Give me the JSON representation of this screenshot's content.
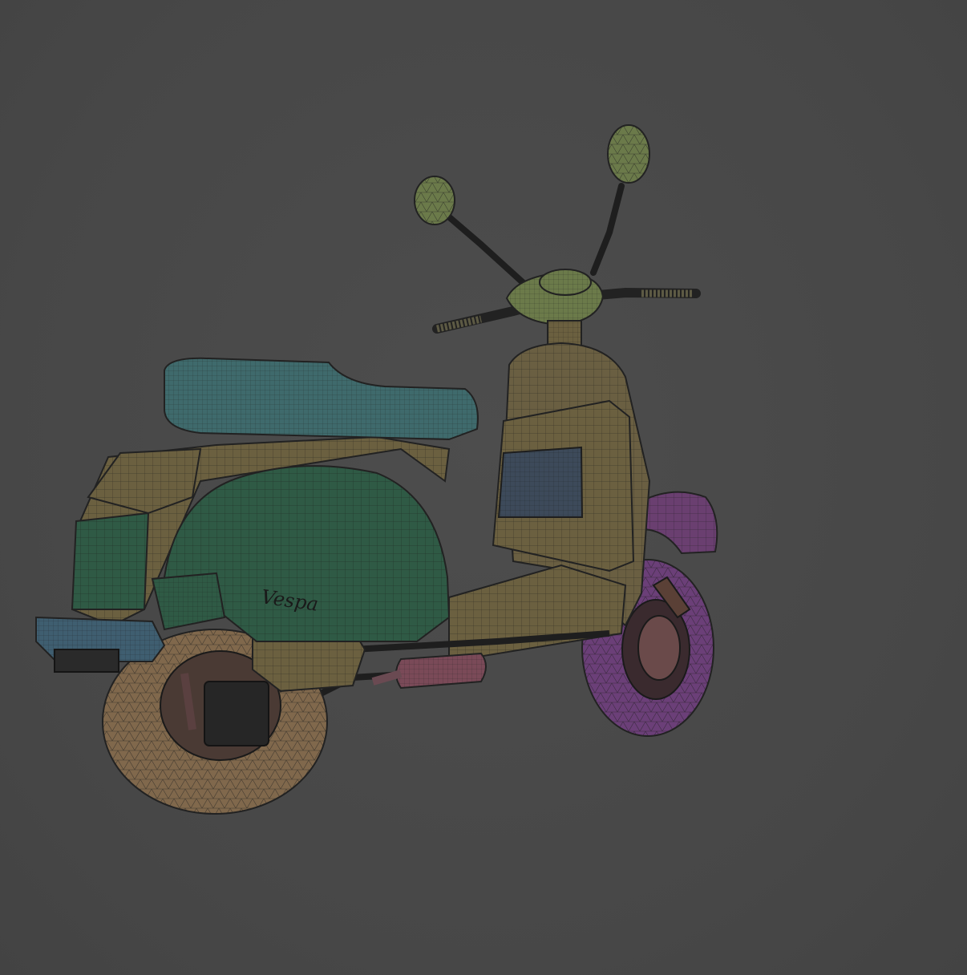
{
  "viewport": {
    "background": "#4a4a4a",
    "display_mode": "wireframe-on-shaded"
  },
  "model": {
    "subject": "scooter",
    "badge_text": "Vespa",
    "parts": {
      "seat": "#3f6a6c",
      "rear_body": "#2f5a45",
      "side_panel": "#6b6040",
      "leg_shield": "#6a5f42",
      "front_fender": "#6a3f70",
      "front_tire": "#6b3f78",
      "rear_tire": "#80684c",
      "mirrors": "#6b7a4a",
      "headset": "#6b7a4a",
      "license_plate": "#3d4a5a",
      "muffler": "#7a4a58",
      "rear_light": "#3f5e70"
    }
  }
}
